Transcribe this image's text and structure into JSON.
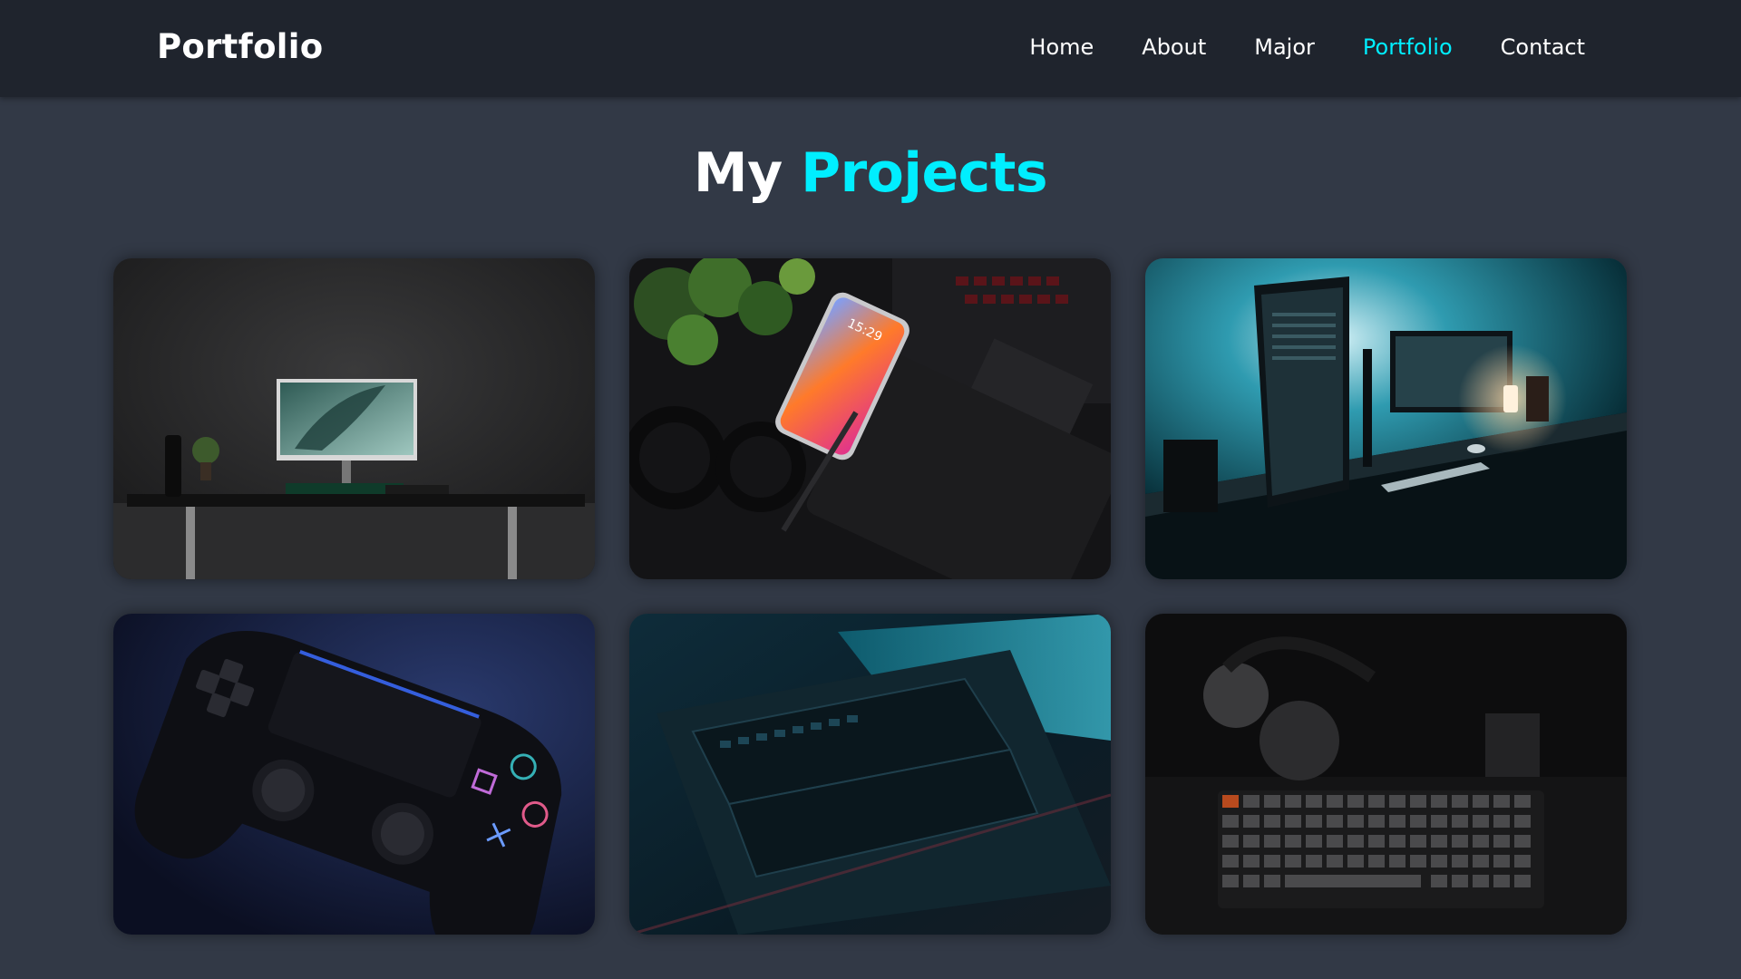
{
  "header": {
    "logo": "Portfolio",
    "nav": [
      {
        "label": "Home",
        "active": false
      },
      {
        "label": "About",
        "active": false
      },
      {
        "label": "Major",
        "active": false
      },
      {
        "label": "Portfolio",
        "active": true
      },
      {
        "label": "Contact",
        "active": false
      }
    ]
  },
  "section": {
    "title_part1": "My",
    "title_part2": "Projects"
  },
  "projects": [
    {
      "image": "desk-setup-photo"
    },
    {
      "image": "phone-headphones-tablet-photo"
    },
    {
      "image": "monitors-desk-photo"
    },
    {
      "image": "game-controller-photo"
    },
    {
      "image": "laptop-keyboard-photo"
    },
    {
      "image": "headphones-keyboard-photo"
    }
  ],
  "phone_time": "15:29",
  "colors": {
    "accent": "#00eeff",
    "navbar_bg": "#1f242d",
    "page_bg": "#323946"
  }
}
